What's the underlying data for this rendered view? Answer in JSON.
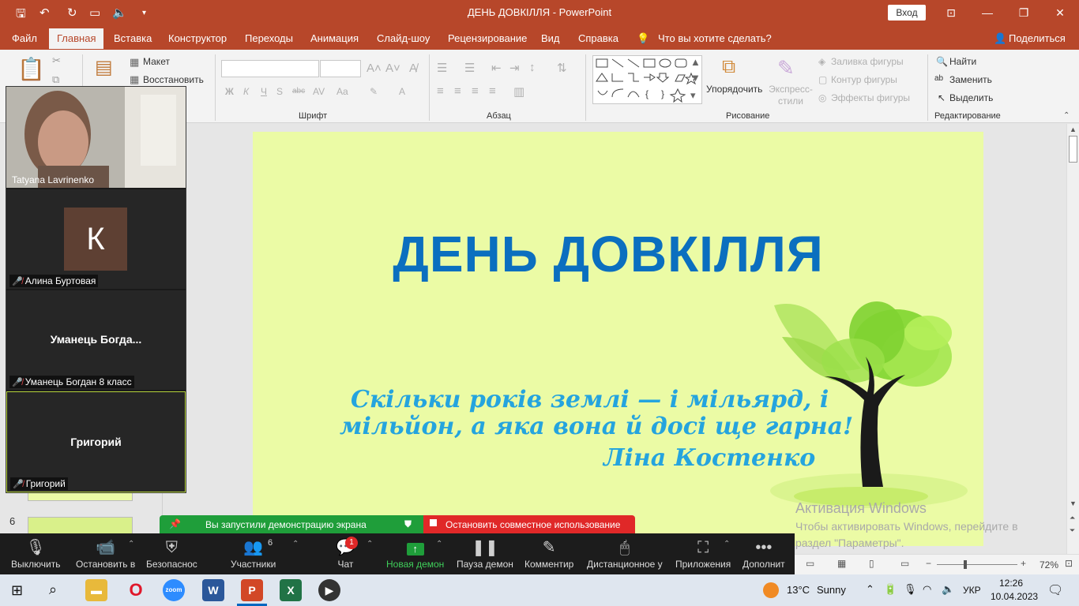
{
  "window": {
    "title": "ДЕНЬ ДОВКІЛЛЯ  -  PowerPoint",
    "signin": "Вход"
  },
  "ribbon_tabs": [
    "Файл",
    "Главная",
    "Вставка",
    "Конструктор",
    "Переходы",
    "Анимация",
    "Слайд-шоу",
    "Рецензирование",
    "Вид",
    "Справка"
  ],
  "tell_me": "Что вы хотите сделать?",
  "share": "Поделиться",
  "ribbon": {
    "layout": "Макет",
    "reset": "Восстановить",
    "font_group": "Шрифт",
    "paragraph_group": "Абзац",
    "drawing_group": "Рисование",
    "editing_group": "Редактирование",
    "arrange": "Упорядочить",
    "quick_styles": "Экспресс-стили",
    "shape_fill": "Заливка фигуры",
    "shape_outline": "Контур фигуры",
    "shape_effects": "Эффекты фигуры",
    "find": "Найти",
    "replace": "Заменить",
    "select": "Выделить",
    "font_bold": "Ж",
    "font_italic": "К",
    "font_underline": "Ч",
    "font_strike": "abc",
    "font_case": "Aa",
    "font_color": "A"
  },
  "slide": {
    "title": "ДЕНЬ ДОВКІЛЛЯ",
    "quote_line1": "Скільки років землі — і мільярд, і",
    "quote_line2": "мільйон, а яка вона й досі ще гарна!",
    "author": "Ліна Костенко"
  },
  "watermark": {
    "line1": "Активация Windows",
    "line2": "Чтобы активировать Windows, перейдите в раздел \"Параметры\"."
  },
  "thumbnail_number": "6",
  "zoom": {
    "participants": [
      {
        "name": "Tatyana Lavrinenko",
        "video": true
      },
      {
        "name": "Алина Буртовая",
        "avatar_letter": "К",
        "muted": true
      },
      {
        "name": "Уманець Богдан 8 класс",
        "display": "Уманець  Богда...",
        "muted": true
      },
      {
        "name": "Григорий",
        "display": "Григорий",
        "muted": true
      }
    ],
    "share_notice": "Вы запустили демонстрацию экрана",
    "stop_share": "Остановить совместное использование",
    "controls": {
      "mute": "Выключить",
      "video": "Остановить в",
      "security": "Безопаснос",
      "participants": "Участники",
      "participants_count": "6",
      "chat": "Чат",
      "chat_badge": "1",
      "new_share": "Новая демон",
      "pause_share": "Пауза демон",
      "annotate": "Комментир",
      "remote": "Дистанционное у",
      "apps": "Приложения",
      "more": "Дополнит"
    }
  },
  "statusbar": {
    "zoom_level": "72%",
    "minus": "−",
    "plus": "+"
  },
  "taskbar": {
    "weather_temp": "13°C",
    "weather_text": "Sunny",
    "lang": "УКР",
    "time": "12:26",
    "date": "10.04.2023"
  },
  "colors": {
    "ppt_brand": "#b7472a",
    "slide_bg": "#ebfba5",
    "title_blue": "#0b6fbf",
    "quote_cyan": "#25a4de",
    "zoom_green": "#1f9e3a",
    "zoom_red": "#e02828"
  }
}
